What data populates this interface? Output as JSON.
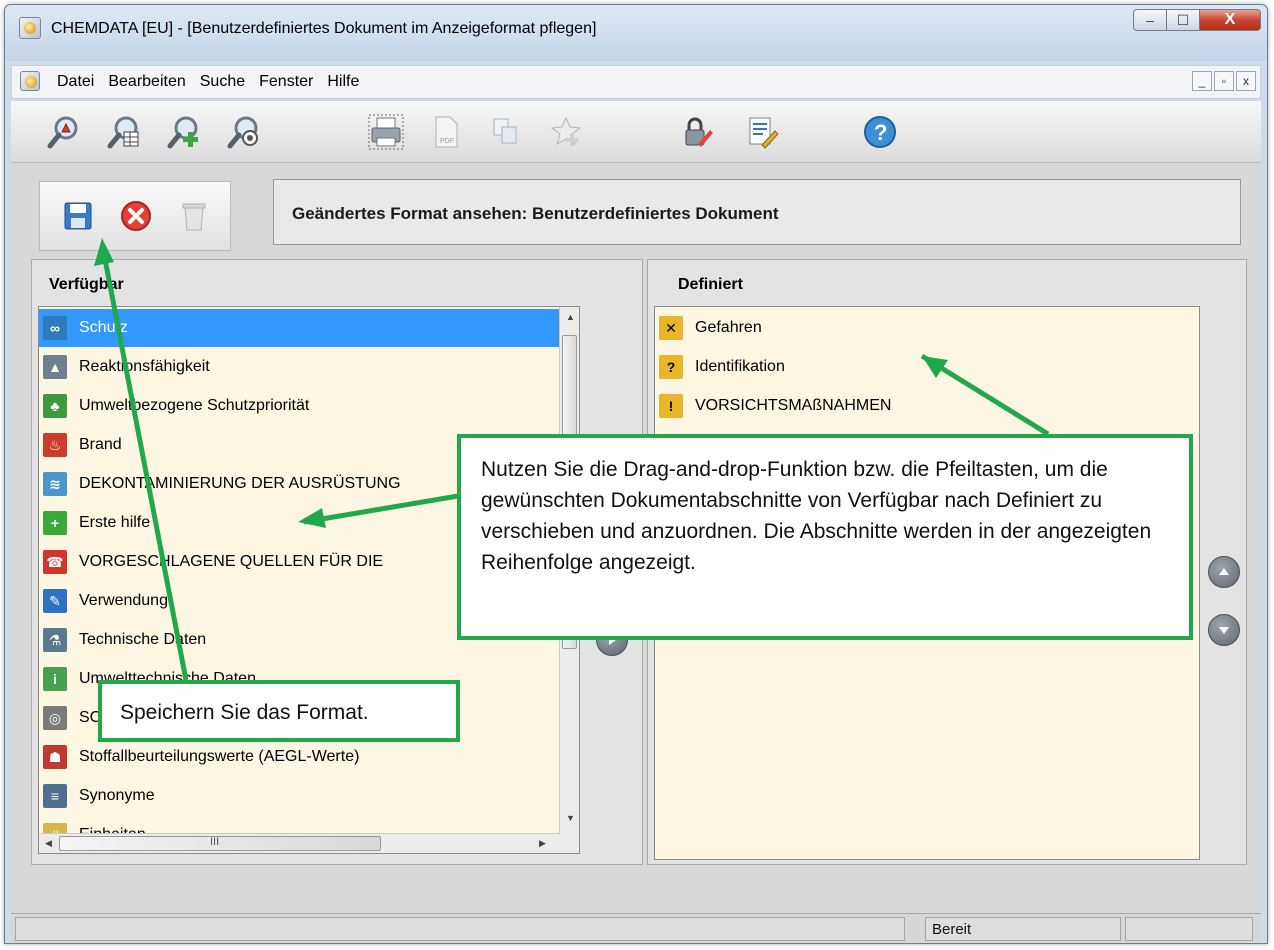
{
  "window": {
    "title": "CHEMDATA   [EU] - [Benutzerdefiniertes Dokument im Anzeigeformat pflegen]",
    "minimize": "–",
    "maximize": "☐",
    "close": "X"
  },
  "menu": {
    "items": [
      "Datei",
      "Bearbeiten",
      "Suche",
      "Fenster",
      "Hilfe"
    ],
    "mdi": [
      "_",
      "▫",
      "x"
    ]
  },
  "header": {
    "text": "Geändertes Format ansehen: Benutzerdefiniertes Dokument"
  },
  "available": {
    "title": "Verfügbar",
    "items": [
      {
        "label": "Schutz",
        "icon": "glasses-icon",
        "color": "#2f7ab8"
      },
      {
        "label": "Reaktionsfähigkeit",
        "icon": "reaction-icon",
        "color": "#6e7f90"
      },
      {
        "label": "Umweltbezogene Schutzpriorität",
        "icon": "trees-icon",
        "color": "#3f9a3f"
      },
      {
        "label": "Brand",
        "icon": "fire-icon",
        "color": "#cc3b2b"
      },
      {
        "label": "DEKONTAMINIERUNG DER AUSRÜSTUNG",
        "icon": "shower-icon",
        "color": "#4a95c9"
      },
      {
        "label": "Erste hilfe",
        "icon": "first-aid-icon",
        "color": "#3aa83a"
      },
      {
        "label": "VORGESCHLAGENE QUELLEN FÜR DIE",
        "icon": "phone-icon",
        "color": "#d1362a"
      },
      {
        "label": "Verwendung",
        "icon": "wrench-icon",
        "color": "#2f72c0"
      },
      {
        "label": "Technische Daten",
        "icon": "flask-icon",
        "color": "#5b7a8f"
      },
      {
        "label": "Umwelttechnische Daten",
        "icon": "env-info-icon",
        "color": "#46a050"
      },
      {
        "label": "SCHUTZ- UND SICHERHEITSABSTÄN",
        "icon": "target-icon",
        "color": "#7a7a7a"
      },
      {
        "label": "Stoffallbeurteilungswerte (AEGL-Werte)",
        "icon": "aegl-icon",
        "color": "#c13a30"
      },
      {
        "label": "Synonyme",
        "icon": "synonym-icon",
        "color": "#4f6f91"
      },
      {
        "label": "Einheiten",
        "icon": "units-icon",
        "color": "#d9b64a"
      }
    ],
    "hscroll_grip": "III"
  },
  "defined": {
    "title": "Definiert",
    "items": [
      {
        "label": "Gefahren",
        "icon": "hazard-icon",
        "color": "#e8b62a"
      },
      {
        "label": "Identifikation",
        "icon": "question-icon",
        "color": "#e8b62a"
      },
      {
        "label": "VORSICHTSMAßNAHMEN",
        "icon": "exclamation-icon",
        "color": "#e8b62a"
      }
    ]
  },
  "status": {
    "text": "Bereit"
  },
  "callouts": {
    "drag_drop": "Nutzen Sie die Drag-and-drop-Funktion bzw. die Pfeiltasten, um die gewünschten Dokumentabschnitte von Verfügbar nach Definiert zu verschieben und anzuordnen. Die Abschnitte werden in der angezeigten Reihenfolge angezeigt.",
    "save": "Speichern Sie das Format."
  },
  "colors": {
    "callout_border": "#21a84a",
    "selection": "#3399ff",
    "list_background": "#fdf6e3"
  }
}
